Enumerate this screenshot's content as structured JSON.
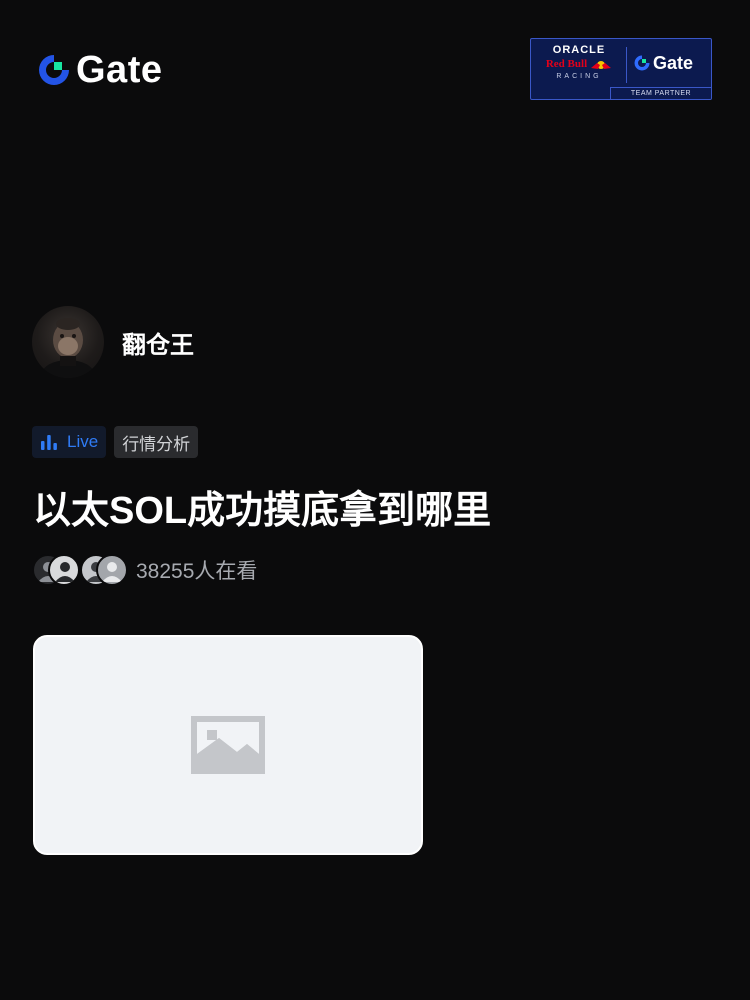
{
  "brand": {
    "name": "Gate",
    "accent_blue": "#2354e6",
    "accent_green": "#17e6a1"
  },
  "partner_badge": {
    "oracle": "ORACLE",
    "redbull": "Red Bull",
    "racing": "RACING",
    "gate": "Gate",
    "footer": "TEAM PARTNER"
  },
  "author": {
    "name": "翻仓王",
    "avatar_icon": "ape-avatar-icon"
  },
  "tags": {
    "live": "Live",
    "live_color": "#2f7bf5",
    "category": "行情分析"
  },
  "title": "以太SOL成功摸底拿到哪里",
  "viewers": {
    "count_text": "38255人在看"
  },
  "image": {
    "icon": "image-placeholder-icon"
  }
}
